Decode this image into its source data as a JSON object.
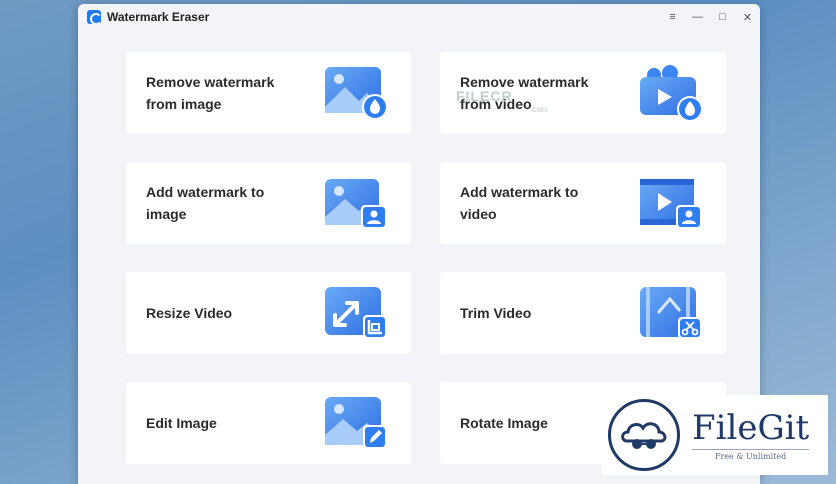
{
  "window": {
    "title": "Watermark Eraser",
    "controls": [
      "≡",
      "—",
      "□",
      "✕"
    ]
  },
  "cards": [
    {
      "label": "Remove watermark from image",
      "icon": "image-drop-icon"
    },
    {
      "label": "Remove watermark from video",
      "icon": "video-drop-icon"
    },
    {
      "label": "Add watermark to image",
      "icon": "image-portrait-icon"
    },
    {
      "label": "Add watermark to video",
      "icon": "video-portrait-icon"
    },
    {
      "label": "Resize Video",
      "icon": "resize-crop-icon"
    },
    {
      "label": "Trim Video",
      "icon": "film-scissors-icon"
    },
    {
      "label": "Edit Image",
      "icon": "image-edit-icon"
    },
    {
      "label": "Rotate Image",
      "icon": "rotate-image-icon"
    }
  ],
  "overlay_watermark": {
    "text": "FILECR",
    "sub": ".com"
  },
  "badge": {
    "name": "FileGit",
    "tagline": "Free & Unlimited"
  },
  "colors": {
    "accent": "#1d7cf2",
    "icon_light": "#7fb2f5",
    "badge_navy": "#1f3a66"
  }
}
